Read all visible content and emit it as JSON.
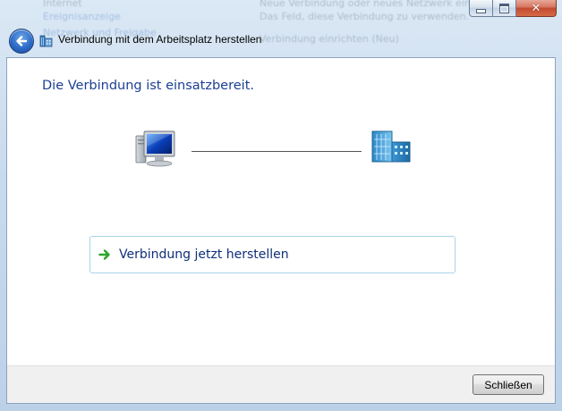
{
  "window": {
    "title": "Verbindung mit dem Arbeitsplatz herstellen"
  },
  "background_ghost": {
    "left_line_1": "Internet",
    "left_line_2": "Ereignisanzeige",
    "left_line_3": "Netzwerk und Freigabe",
    "right_line_1": "Neue Verbindung oder neues Netzwerk einrichten",
    "right_line_2": "Das Feld, diese Verbindung zu verwenden.",
    "right_line_3": "Verbindung einrichten (Neu)"
  },
  "content": {
    "heading": "Die Verbindung ist einsatzbereit.",
    "connect_now": "Verbindung jetzt herstellen"
  },
  "footer": {
    "close_label": "Schließen"
  },
  "icons": {
    "back": "back-arrow-icon",
    "title": "workplace-network-icon",
    "computer": "computer-icon",
    "server": "workplace-server-icon",
    "command_arrow": "green-arrow-icon"
  },
  "colors": {
    "heading": "#1c3f94",
    "link_text": "#0f2e7a",
    "link_border": "#a9d4e8",
    "arrow_green": "#2aa52a"
  }
}
